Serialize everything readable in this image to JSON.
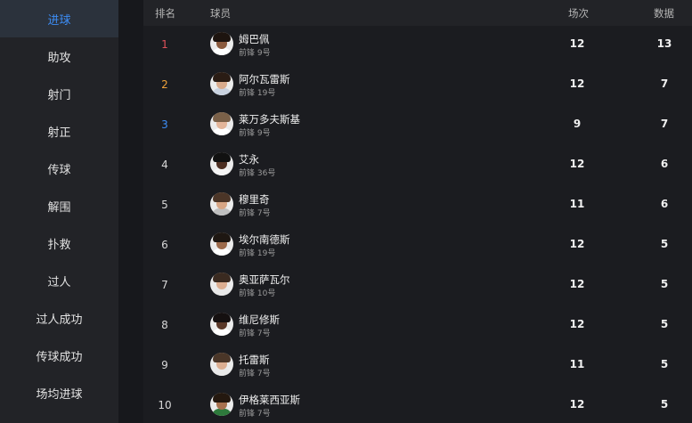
{
  "sidebar": {
    "items": [
      {
        "label": "进球",
        "active": true
      },
      {
        "label": "助攻"
      },
      {
        "label": "射门"
      },
      {
        "label": "射正"
      },
      {
        "label": "传球"
      },
      {
        "label": "解围"
      },
      {
        "label": "扑救"
      },
      {
        "label": "过人"
      },
      {
        "label": "过人成功"
      },
      {
        "label": "传球成功"
      },
      {
        "label": "场均进球"
      }
    ]
  },
  "table": {
    "headers": {
      "rank": "排名",
      "player": "球员",
      "apps": "场次",
      "stat": "数据"
    },
    "rows": [
      {
        "rank": "1",
        "rank_color": "#e0525b",
        "name": "姆巴佩",
        "position": "前锋 9号",
        "apps": "12",
        "stat": "13",
        "skin": "#8a5a3d",
        "hair": "#1d140f",
        "kit": "#ffffff"
      },
      {
        "rank": "2",
        "rank_color": "#f0a23a",
        "name": "阿尔瓦雷斯",
        "position": "前锋 19号",
        "apps": "12",
        "stat": "7",
        "skin": "#d9ab8c",
        "hair": "#2a1c14",
        "kit": "#c9d2e0"
      },
      {
        "rank": "3",
        "rank_color": "#3d8df5",
        "name": "莱万多夫斯基",
        "position": "前锋 9号",
        "apps": "9",
        "stat": "7",
        "skin": "#e3b599",
        "hair": "#7a6048",
        "kit": "#ffffff"
      },
      {
        "rank": "4",
        "rank_color": "#d8d8d8",
        "name": "艾永",
        "position": "前锋 36号",
        "apps": "12",
        "stat": "6",
        "skin": "#4d2f22",
        "hair": "#111111",
        "kit": "#f5f5f5"
      },
      {
        "rank": "5",
        "rank_color": "#d8d8d8",
        "name": "穆里奇",
        "position": "前锋 7号",
        "apps": "11",
        "stat": "6",
        "skin": "#d7a584",
        "hair": "#4b3527",
        "kit": "#bfbfbf"
      },
      {
        "rank": "6",
        "rank_color": "#d8d8d8",
        "name": "埃尔南德斯",
        "position": "前锋 19号",
        "apps": "12",
        "stat": "5",
        "skin": "#9c6a4b",
        "hair": "#1e1712",
        "kit": "#ffffff"
      },
      {
        "rank": "7",
        "rank_color": "#d8d8d8",
        "name": "奥亚萨瓦尔",
        "position": "前锋 10号",
        "apps": "12",
        "stat": "5",
        "skin": "#dcae91",
        "hair": "#3a2a20",
        "kit": "#e8e8e8"
      },
      {
        "rank": "8",
        "rank_color": "#d8d8d8",
        "name": "维尼修斯",
        "position": "前锋 7号",
        "apps": "12",
        "stat": "5",
        "skin": "#5a3828",
        "hair": "#151010",
        "kit": "#ffffff"
      },
      {
        "rank": "9",
        "rank_color": "#d8d8d8",
        "name": "托雷斯",
        "position": "前锋 7号",
        "apps": "11",
        "stat": "5",
        "skin": "#dcae91",
        "hair": "#4a3628",
        "kit": "#e9e9e9"
      },
      {
        "rank": "10",
        "rank_color": "#d8d8d8",
        "name": "伊格莱西亚斯",
        "position": "前锋 7号",
        "apps": "12",
        "stat": "5",
        "skin": "#a8714f",
        "hair": "#24180f",
        "kit": "#2e7a3c"
      }
    ]
  }
}
